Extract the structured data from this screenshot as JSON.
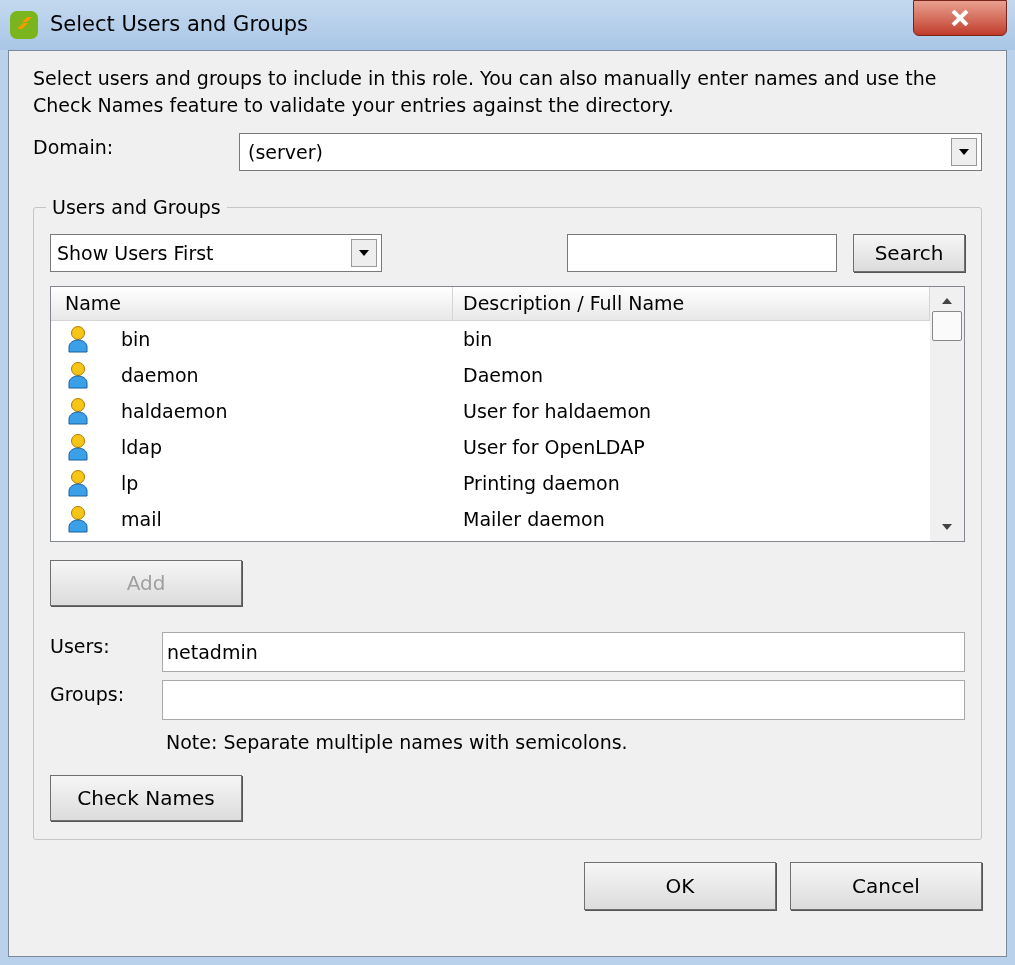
{
  "window": {
    "title": "Select Users and Groups"
  },
  "intro": "Select users and groups to include in this role. You can also manually enter names and use the Check Names feature to validate your entries against the directory.",
  "domain": {
    "label": "Domain:",
    "value": "(server)"
  },
  "group_box": {
    "title": "Users and Groups",
    "order": {
      "value": "Show Users First"
    },
    "search": {
      "button": "Search"
    },
    "table": {
      "columns": [
        "Name",
        "Description / Full Name"
      ],
      "rows": [
        {
          "name": "bin",
          "description": "bin"
        },
        {
          "name": "daemon",
          "description": "Daemon"
        },
        {
          "name": "haldaemon",
          "description": "User for haldaemon"
        },
        {
          "name": "ldap",
          "description": "User for OpenLDAP"
        },
        {
          "name": "lp",
          "description": "Printing daemon"
        },
        {
          "name": "mail",
          "description": "Mailer daemon"
        }
      ]
    },
    "add_button": {
      "label": "Add",
      "disabled": true
    },
    "users": {
      "label": "Users:",
      "value": "netadmin"
    },
    "groups": {
      "label": "Groups:"
    },
    "note": "Note: Separate multiple names with semicolons.",
    "check_button": "Check Names"
  },
  "buttons": [
    "OK",
    "Cancel"
  ]
}
